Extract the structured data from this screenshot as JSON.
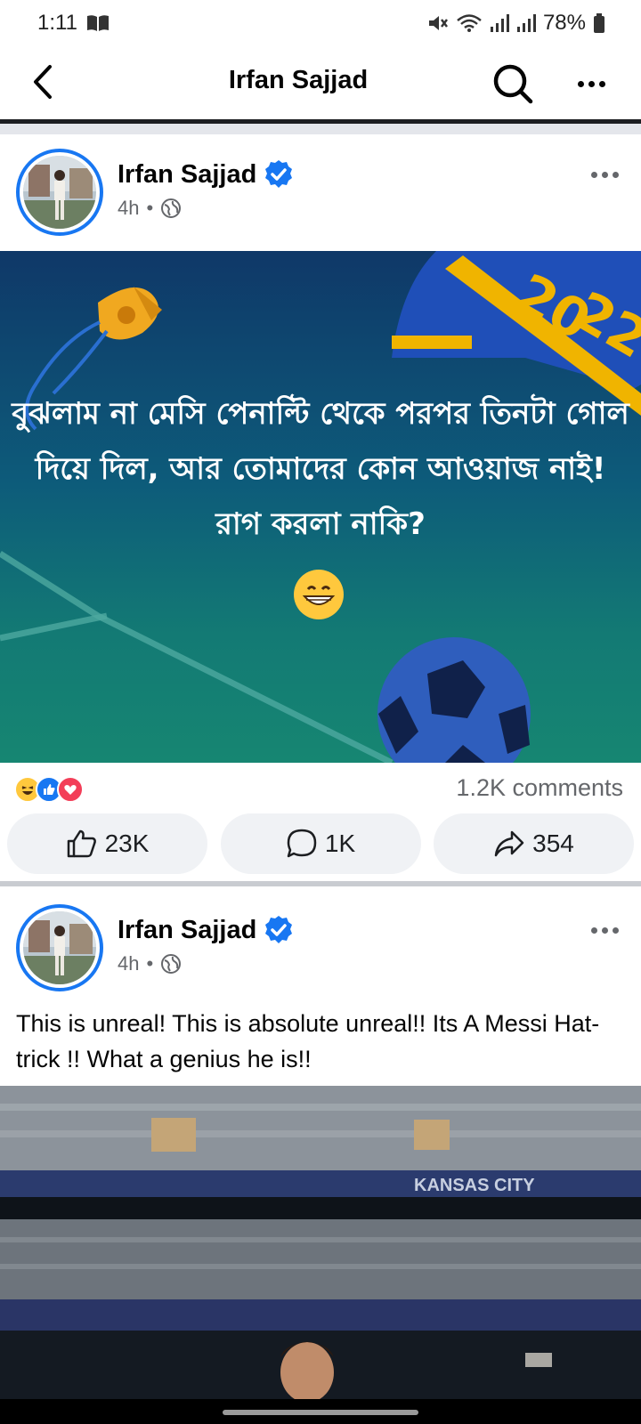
{
  "status_bar": {
    "time": "1:11",
    "battery": "78%"
  },
  "nav": {
    "title": "Irfan Sajjad"
  },
  "posts": [
    {
      "author": "Irfan Sajjad",
      "time": "4h",
      "image_text": "বুঝলাম না মেসি পেনাল্টি থেকে পরপর তিনটা গোল দিয়ে দিল, আর তোমাদের কোন আওয়াজ নাই! রাগ করলা নাকি?",
      "comments_label": "1.2K comments",
      "likes": "23K",
      "comments": "1K",
      "shares": "354"
    },
    {
      "author": "Irfan Sajjad",
      "time": "4h",
      "text": "This is unreal! This is absolute unreal!! Its A Messi Hat-trick !! What a genius he is!!",
      "stadium_sign": "KANSAS CITY"
    }
  ],
  "colors": {
    "brand_blue": "#1877f2",
    "muted": "#65676b",
    "button_bg": "#f0f2f5"
  }
}
